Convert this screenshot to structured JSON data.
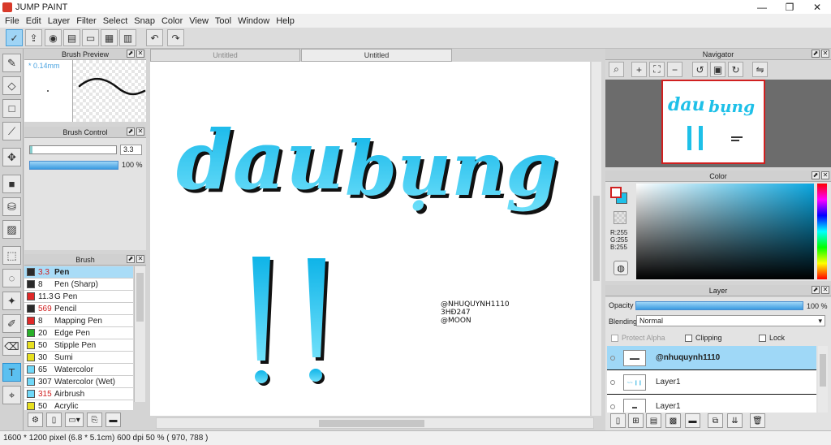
{
  "window": {
    "title": "JUMP PAINT",
    "min": "—",
    "max": "❐",
    "close": "✕"
  },
  "menu": [
    "File",
    "Edit",
    "Layer",
    "Filter",
    "Select",
    "Snap",
    "Color",
    "View",
    "Tool",
    "Window",
    "Help"
  ],
  "panels": {
    "brush_preview": "Brush Preview",
    "brush_control": "Brush Control",
    "brush": "Brush",
    "navigator": "Navigator",
    "color": "Color",
    "layer": "Layer"
  },
  "brush_preview": {
    "size": "* 0.14mm"
  },
  "brush_control": {
    "size_value": "3.3",
    "opacity_value": "100 %"
  },
  "brushes": [
    {
      "num": "3.3",
      "name": "Pen",
      "color": "#2a2a2a",
      "selected": true,
      "red": true
    },
    {
      "num": "8",
      "name": "Pen (Sharp)",
      "color": "#2a2a2a"
    },
    {
      "num": "11.3",
      "name": "G Pen",
      "color": "#e02828"
    },
    {
      "num": "569",
      "name": "Pencil",
      "color": "#2a2a2a",
      "red": true
    },
    {
      "num": "8",
      "name": "Mapping Pen",
      "color": "#e02828"
    },
    {
      "num": "20",
      "name": "Edge Pen",
      "color": "#28b028"
    },
    {
      "num": "50",
      "name": "Stipple Pen",
      "color": "#e8e020"
    },
    {
      "num": "30",
      "name": "Sumi",
      "color": "#e8e020"
    },
    {
      "num": "65",
      "name": "Watercolor",
      "color": "#70d8f8"
    },
    {
      "num": "307",
      "name": "Watercolor (Wet)",
      "color": "#70d8f8"
    },
    {
      "num": "315",
      "name": "Airbrush",
      "color": "#70d8f8",
      "red": true
    },
    {
      "num": "50",
      "name": "Acrylic",
      "color": "#e8e020"
    }
  ],
  "tabs": [
    "Untitled",
    "Untitled"
  ],
  "canvas": {
    "word1": "dau",
    "word2": "bụng",
    "marks": "!!",
    "credits": [
      "@NHUQUYNH1110",
      "3HĐ247",
      "@MOON"
    ]
  },
  "color": {
    "r": "R:255",
    "g": "G:255",
    "b": "B:255",
    "fg": "#ffffff",
    "bg": "#1ec0e8"
  },
  "layer": {
    "opacity_label": "Opacity",
    "opacity_value": "100 %",
    "opacity_fraction": 1.0,
    "blending_label": "Blending",
    "blending_value": "Normal",
    "protect_alpha": "Protect Alpha",
    "clipping": "Clipping",
    "lock": "Lock",
    "layers": [
      {
        "name": "@nhuquynh1110",
        "selected": true
      },
      {
        "name": "Layer1"
      },
      {
        "name": "Layer1"
      }
    ]
  },
  "status": "1600 * 1200 pixel   (6.8 * 5.1cm)   600 dpi   50 %   ( 970, 788 )",
  "accent": "#1ec0e8"
}
